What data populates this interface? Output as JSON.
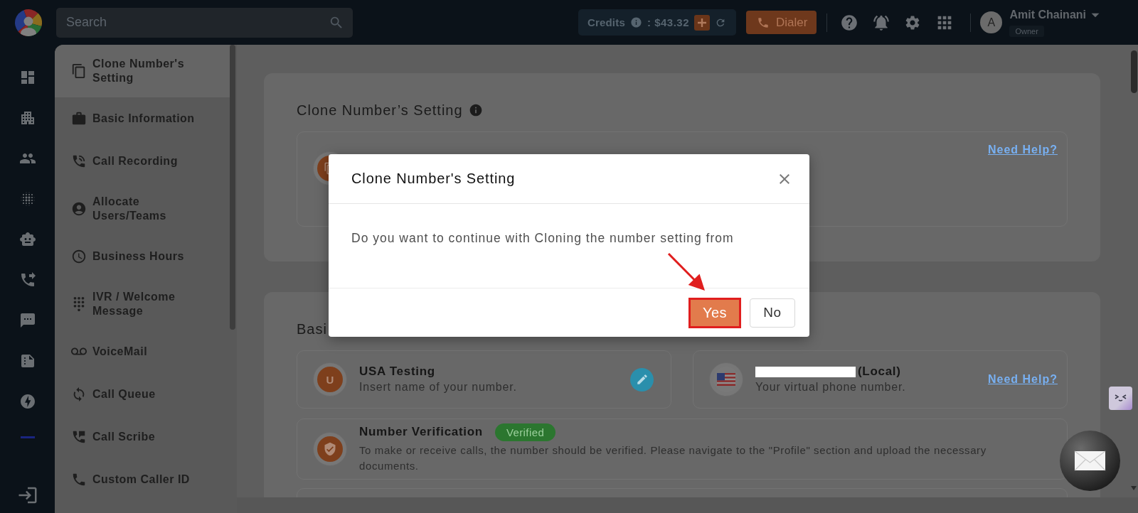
{
  "topbar": {
    "search": {
      "placeholder": "Search"
    },
    "credits": {
      "label": "Credits",
      "amount": ": $43.32"
    },
    "dialer": {
      "label": "Dialer"
    },
    "user": {
      "initial": "A",
      "name": "Amit Chainani",
      "role": "Owner"
    }
  },
  "nav": {
    "items": [
      {
        "label": "Clone Number's Setting",
        "selected": true
      },
      {
        "label": "Basic Information",
        "selected": false
      },
      {
        "label": "Call Recording",
        "selected": false
      },
      {
        "label": "Allocate Users/Teams",
        "selected": false
      },
      {
        "label": "Business Hours",
        "selected": false
      },
      {
        "label": "IVR / Welcome Message",
        "selected": false
      },
      {
        "label": "VoiceMail",
        "selected": false
      },
      {
        "label": "Call Queue",
        "selected": false
      },
      {
        "label": "Call Scribe",
        "selected": false
      },
      {
        "label": "Custom Caller ID",
        "selected": false
      }
    ]
  },
  "clone_card": {
    "title": "Clone Number’s Setting",
    "link": "Need Help?"
  },
  "basic_card": {
    "title": "Basi",
    "fields": [
      {
        "kind": "name",
        "avatar": "U",
        "title": "USA Testing",
        "hint": "Insert name of your number."
      },
      {
        "kind": "number",
        "redacted": true,
        "title": "(Local)",
        "hint": "Your virtual phone number.",
        "link": "Need Help?"
      }
    ],
    "verification": {
      "title": "Number Verification",
      "status": "Verified",
      "verified": true,
      "description": "To make or receive calls, the number should be verified. Please navigate to the \"Profile\" section and upload the necessary documents."
    }
  },
  "modal": {
    "title": "Clone Number's Setting",
    "message": "Do you want to continue with Cloning the number setting from",
    "buttons": [
      {
        "label": "Yes",
        "kind": "primary",
        "highlighted": true
      },
      {
        "label": "No",
        "kind": "secondary",
        "highlighted": false
      }
    ]
  }
}
